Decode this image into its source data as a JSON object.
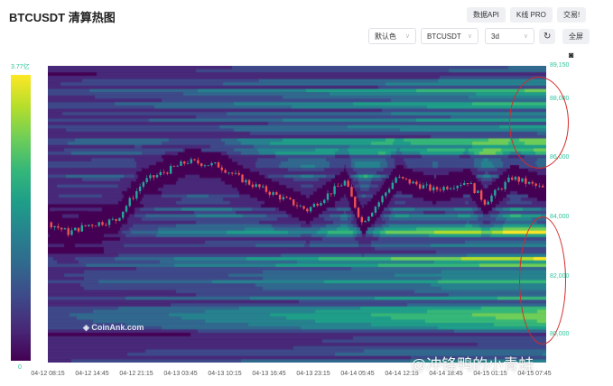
{
  "header": {
    "title": "BTCUSDT 清算热图",
    "buttons": [
      "数据API",
      "K线 PRO",
      "交易!"
    ]
  },
  "controls": {
    "color_scheme": "默认色",
    "symbol": "BTCUSDT",
    "range": "3d",
    "refresh_icon": "refresh-icon",
    "fullscreen": "全屏",
    "camera_icon": "camera-icon"
  },
  "colorbar": {
    "max": "3.77亿",
    "min": "0"
  },
  "watermarks": {
    "logo": "CoinAnk.com",
    "user": "@冲锋鸭的小青蛙"
  },
  "chart_data": {
    "type": "heatmap",
    "title": "BTCUSDT 清算热图",
    "y_ticks": [
      "89,150",
      "88,000",
      "86,000",
      "84,000",
      "82,000",
      "80,000"
    ],
    "ylim": [
      78000,
      89150
    ],
    "x_ticks": [
      "04-12 08:15",
      "04-12 14:45",
      "04-12 21:15",
      "04-13 03:45",
      "04-13 10:15",
      "04-13 16:45",
      "04-13 23:15",
      "04-14 05:45",
      "04-14 12:15",
      "04-14 18:45",
      "04-15 01:15",
      "04-15 07:45"
    ],
    "price_path": {
      "hours": [
        0,
        3,
        6,
        10,
        14,
        20.5,
        25,
        29,
        33,
        38,
        43.5,
        46,
        48.5,
        51,
        56.5,
        61.5,
        64,
        68,
        73
      ],
      "price": [
        83270,
        82880,
        83180,
        83360,
        84800,
        85560,
        85400,
        84800,
        84340,
        83730,
        84800,
        83270,
        84030,
        84950,
        84490,
        84800,
        84030,
        84950,
        84490
      ]
    },
    "annotations": [
      "red ellipse around liquidity 86,000–88,800",
      "red ellipse around liquidity 80,000–83,800"
    ],
    "colors": {
      "low": "#440154",
      "high": "#fde725",
      "candle_up": "#26a69a",
      "candle_down": "#ef5350"
    }
  }
}
